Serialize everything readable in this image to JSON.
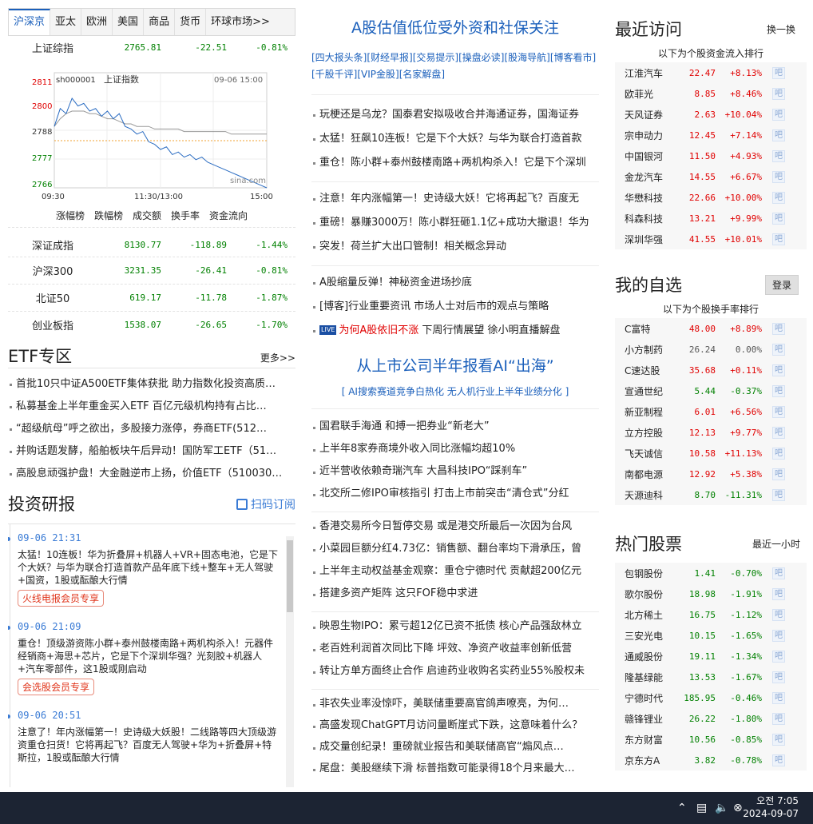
{
  "left": {
    "tabs": [
      "沪深京",
      "亚太",
      "欧洲",
      "美国",
      "商品",
      "货币",
      "环球市场>>"
    ],
    "top_index": {
      "name": "上证综指",
      "value": "2765.81",
      "change": "-22.51",
      "pct": "-0.81%"
    },
    "chart": {
      "code": "sh000001",
      "name": "上证指数",
      "datetime": "09-06 15:00",
      "y_ticks": [
        "2811",
        "2800",
        "2788",
        "2777",
        "2766"
      ],
      "x_ticks": [
        "09:30",
        "11:30/13:00",
        "15:00"
      ],
      "watermark": "sina.com",
      "colors": {
        "price": "#2a6cc2",
        "avg": "#999999",
        "base": "#f0a030",
        "up": "#e00000",
        "down": "#008000"
      }
    },
    "chart_links": [
      "涨幅榜",
      "跌幅榜",
      "成交额",
      "换手率",
      "资金流向"
    ],
    "indices": [
      {
        "name": "深证成指",
        "value": "8130.77",
        "change": "-118.89",
        "pct": "-1.44%"
      },
      {
        "name": "沪深300",
        "value": "3231.35",
        "change": "-26.41",
        "pct": "-0.81%"
      },
      {
        "name": "北证50",
        "value": "619.17",
        "change": "-11.78",
        "pct": "-1.87%"
      },
      {
        "name": "创业板指",
        "value": "1538.07",
        "change": "-26.65",
        "pct": "-1.70%"
      }
    ],
    "etf": {
      "title": "ETF专区",
      "more": "更多>>",
      "items": [
        "首批10只中证A500ETF集体获批 助力指数化投资高质…",
        "私募基金上半年重金买入ETF 百亿元级机构持有占比…",
        "“超级航母”呼之欲出，多股接力涨停，券商ETF(512…",
        "并购话题发酵，船舶板块午后异动！国防军工ETF（51…",
        "高股息顽强护盘！大金融逆市上扬，价值ETF（510030…"
      ]
    },
    "research": {
      "title": "投资研报",
      "subscribe": "扫码订阅",
      "items": [
        {
          "time": "09-06 21:31",
          "text": "太猛！10连板！华为折叠屏+机器人+VR+固态电池，它是下个大妖？与华为联合打造首款产品年底下线+整车+无人驾驶 +国资，1股或酝酿大行情",
          "tag": "火线电报会员专享"
        },
        {
          "time": "09-06 21:09",
          "text": "重仓！顶级游资陈小群+泰州鼓楼南路+两机构杀入！元器件经销商+海思+芯片，它是下个深圳华强？光刻胶+机器人+汽车零部件，这1股或刚启动",
          "tag": "会选股会员专享"
        },
        {
          "time": "09-06 20:51",
          "text": "注意了！年内涨幅第一！史诗级大妖股！二线路等四大顶级游资重仓扫货！它将再起飞？百度无人驾驶+华为+折叠屏+特斯拉，1股或酝酿大行情",
          "tag": ""
        }
      ]
    }
  },
  "mid": {
    "title1": "A股估值低位受外资和社保关注",
    "links": [
      "[四大报头条]",
      "[财经早报]",
      "[交易提示]",
      "[操盘必读]",
      "[股海导航]",
      "[博客看市]",
      "[千股千评]",
      "[VIP金股]",
      "[名家解盘]"
    ],
    "group1": [
      "玩梗还是乌龙？国泰君安拟吸收合并海通证券，国海证券",
      "太猛！狂飙10连板！它是下个大妖？与华为联合打造首款",
      "重仓！陈小群+泰州鼓楼南路+两机构杀入！它是下个深圳"
    ],
    "group2": [
      "注意！年内涨幅第一！史诗级大妖！它将再起飞？百度无",
      "重磅！暴赚3000万！陈小群狂砸1.1亿+成功大撤退！华为",
      "突发！荷兰扩大出口管制！相关概念异动"
    ],
    "group3": [
      "A股缩量反弹！神秘资金进场抄底",
      "[博客]行业重要资讯 市场人士对后市的观点与策略"
    ],
    "live": {
      "badge": "LIVE",
      "highlight": "为何A股依旧不涨",
      "rest": "下周行情展望 徐小明直播解盘"
    },
    "title2": "从上市公司半年报看AI“出海”",
    "subtitle2": "[ AI搜索赛道竞争白热化 无人机行业上半年业绩分化 ]",
    "group4": [
      "国君联手海通 和搏一把券业“新老大”",
      "上半年8家券商境外收入同比涨幅均超10%",
      "近半营收依赖奇瑞汽车 大昌科技IPO“踩刹车”",
      "北交所二修IPO审核指引 打击上市前突击“清仓式”分红"
    ],
    "group5": [
      "香港交易所今日暂停交易 或是港交所最后一次因为台风",
      "小菜园巨额分红4.73亿：销售额、翻台率均下滑承压，曾",
      "上半年主动权益基金观察：重仓宁德时代 贡献超200亿元",
      "搭建多资产矩阵 这只FOF稳中求进"
    ],
    "group6": [
      "映恩生物IPO：累亏超12亿已资不抵债 核心产品强敌林立",
      "老百姓利润首次同比下降 坪效、净资产收益率创新低营",
      "转让方单方面终止合作 启迪药业收购名实药业55%股权未"
    ],
    "group7": [
      "非农失业率没惊吓，美联储重要高官鸽声嘹亮，为何…",
      "高盛发现ChatGPT月访问量断崖式下跌，这意味着什么？",
      "成交量创纪录！重磅就业报告和美联储高官“煽风点…",
      "尾盘：美股继续下滑 标普指数可能录得18个月来最大…"
    ]
  },
  "right": {
    "recent": {
      "title": "最近访问",
      "btn": "换一换",
      "sub": "以下为个股资金流入排行",
      "rows": [
        {
          "name": "江淮汽车",
          "price": "22.47",
          "pct": "+8.13%",
          "dir": "up"
        },
        {
          "name": "欧菲光",
          "price": "8.85",
          "pct": "+8.46%",
          "dir": "up"
        },
        {
          "name": "天风证券",
          "price": "2.63",
          "pct": "+10.04%",
          "dir": "up"
        },
        {
          "name": "宗申动力",
          "price": "12.45",
          "pct": "+7.14%",
          "dir": "up"
        },
        {
          "name": "中国银河",
          "price": "11.50",
          "pct": "+4.93%",
          "dir": "up"
        },
        {
          "name": "金龙汽车",
          "price": "14.55",
          "pct": "+6.67%",
          "dir": "up"
        },
        {
          "name": "华懋科技",
          "price": "22.66",
          "pct": "+10.00%",
          "dir": "up"
        },
        {
          "name": "科森科技",
          "price": "13.21",
          "pct": "+9.99%",
          "dir": "up"
        },
        {
          "name": "深圳华强",
          "price": "41.55",
          "pct": "+10.01%",
          "dir": "up"
        }
      ]
    },
    "watch": {
      "title": "我的自选",
      "btn": "登录",
      "sub": "以下为个股换手率排行",
      "rows": [
        {
          "name": "C富特",
          "price": "48.00",
          "pct": "+8.89%",
          "dir": "up"
        },
        {
          "name": "小方制药",
          "price": "26.24",
          "pct": "0.00%",
          "dir": "flat"
        },
        {
          "name": "C速达股",
          "price": "35.68",
          "pct": "+0.11%",
          "dir": "up"
        },
        {
          "name": "宣通世纪",
          "price": "5.44",
          "pct": "-0.37%",
          "dir": "down"
        },
        {
          "name": "新亚制程",
          "price": "6.01",
          "pct": "+6.56%",
          "dir": "up"
        },
        {
          "name": "立方控股",
          "price": "12.13",
          "pct": "+9.77%",
          "dir": "up"
        },
        {
          "name": "飞天诚信",
          "price": "10.58",
          "pct": "+11.13%",
          "dir": "up"
        },
        {
          "name": "南都电源",
          "price": "12.92",
          "pct": "+5.38%",
          "dir": "up"
        },
        {
          "name": "天源迪科",
          "price": "8.70",
          "pct": "-11.31%",
          "dir": "down"
        }
      ]
    },
    "hot": {
      "title": "热门股票",
      "btn": "最近一小时",
      "rows": [
        {
          "name": "包钢股份",
          "price": "1.41",
          "pct": "-0.70%",
          "dir": "down"
        },
        {
          "name": "歌尔股份",
          "price": "18.98",
          "pct": "-1.91%",
          "dir": "down"
        },
        {
          "name": "北方稀土",
          "price": "16.75",
          "pct": "-1.12%",
          "dir": "down"
        },
        {
          "name": "三安光电",
          "price": "10.15",
          "pct": "-1.65%",
          "dir": "down"
        },
        {
          "name": "通威股份",
          "price": "19.11",
          "pct": "-1.34%",
          "dir": "down"
        },
        {
          "name": "隆基绿能",
          "price": "13.53",
          "pct": "-1.67%",
          "dir": "down"
        },
        {
          "name": "宁德时代",
          "price": "185.95",
          "pct": "-0.46%",
          "dir": "down"
        },
        {
          "name": "赣锋锂业",
          "price": "26.22",
          "pct": "-1.80%",
          "dir": "down"
        },
        {
          "name": "东方财富",
          "price": "10.56",
          "pct": "-0.85%",
          "dir": "down"
        },
        {
          "name": "京东方A",
          "price": "3.82",
          "pct": "-0.78%",
          "dir": "down"
        }
      ]
    },
    "bar_label": "吧"
  },
  "taskbar": {
    "time": "오전 7:05",
    "date": "2024-09-07",
    "icons": [
      "chevron-up-icon",
      "network-icon",
      "volume-icon",
      "close-circle-icon"
    ]
  }
}
